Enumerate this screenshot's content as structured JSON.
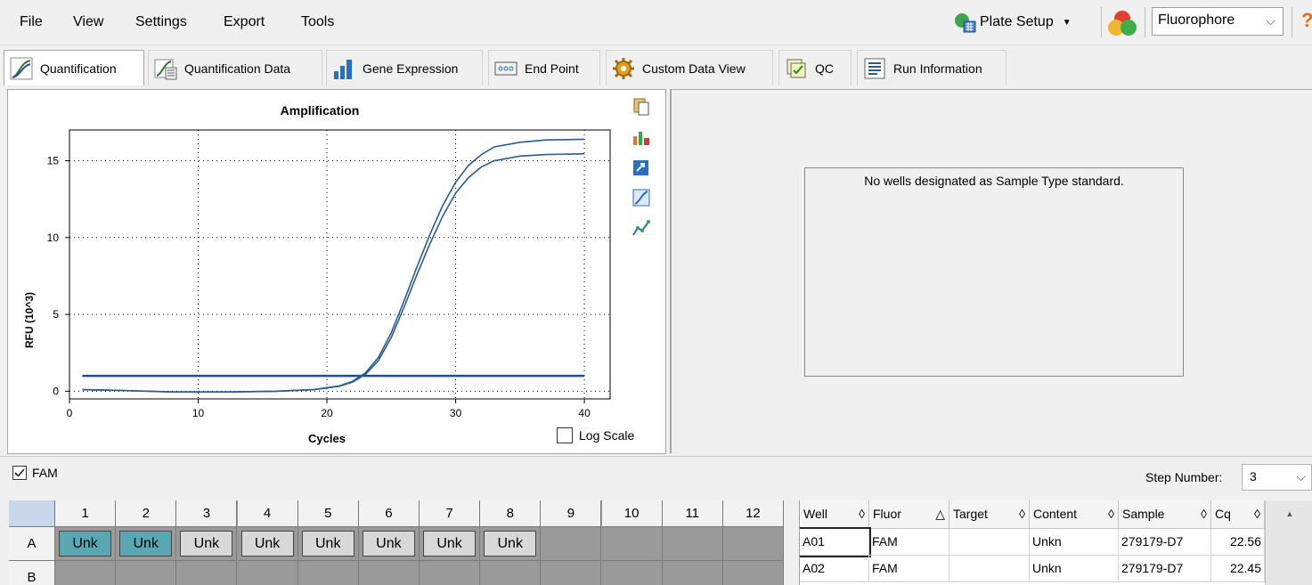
{
  "menu": [
    "File",
    "View",
    "Settings",
    "Export",
    "Tools"
  ],
  "toolbar": {
    "plate_setup_label": "Plate Setup",
    "fluorophore_label": "Fluorophore"
  },
  "tabs": [
    {
      "label": "Quantification"
    },
    {
      "label": "Quantification Data"
    },
    {
      "label": "Gene Expression"
    },
    {
      "label": "End Point"
    },
    {
      "label": "Custom Data View"
    },
    {
      "label": "QC"
    },
    {
      "label": "Run Information"
    }
  ],
  "chart_data": {
    "type": "line",
    "title": "Amplification",
    "xlabel": "Cycles",
    "ylabel": "RFU (10^3)",
    "xlim": [
      0,
      42
    ],
    "ylim": [
      -0.5,
      17
    ],
    "xticks": [
      0,
      10,
      20,
      30,
      40
    ],
    "yticks": [
      0,
      5,
      10,
      15
    ],
    "grid": "dotted",
    "threshold": 1.0,
    "series": [
      {
        "x": [
          1,
          4,
          8,
          12,
          16,
          19,
          21,
          22,
          23,
          24,
          25,
          26,
          27,
          28,
          29,
          30,
          31,
          32,
          33,
          35,
          37,
          40
        ],
        "y": [
          0.1,
          0.05,
          -0.05,
          -0.05,
          0.0,
          0.1,
          0.35,
          0.65,
          1.2,
          2.2,
          3.8,
          5.9,
          8.1,
          10.2,
          12.1,
          13.6,
          14.7,
          15.4,
          15.9,
          16.2,
          16.35,
          16.4
        ]
      },
      {
        "x": [
          1,
          4,
          8,
          12,
          16,
          19,
          21,
          22,
          23,
          24,
          25,
          26,
          27,
          28,
          29,
          30,
          31,
          32,
          33,
          35,
          37,
          40
        ],
        "y": [
          0.1,
          0.05,
          -0.05,
          -0.05,
          0.0,
          0.1,
          0.33,
          0.6,
          1.1,
          2.0,
          3.5,
          5.5,
          7.6,
          9.6,
          11.4,
          12.9,
          13.9,
          14.6,
          15.0,
          15.3,
          15.4,
          15.45
        ]
      }
    ]
  },
  "log_scale_label": "Log Scale",
  "std_message": "No wells designated as Sample Type standard.",
  "filter": {
    "fam_label": "FAM",
    "step_label": "Step Number:",
    "step_value": "3"
  },
  "plate": {
    "columns": [
      "1",
      "2",
      "3",
      "4",
      "5",
      "6",
      "7",
      "8",
      "9",
      "10",
      "11",
      "12"
    ],
    "rows": [
      {
        "label": "A",
        "cells": [
          "Unk",
          "Unk",
          "Unk",
          "Unk",
          "Unk",
          "Unk",
          "Unk",
          "Unk",
          "",
          "",
          "",
          ""
        ]
      },
      {
        "label": "B",
        "cells": [
          "",
          "",
          "",
          "",
          "",
          "",
          "",
          "",
          "",
          "",
          "",
          ""
        ]
      }
    ]
  },
  "results": {
    "headers": [
      "Well",
      "Fluor",
      "Target",
      "Content",
      "Sample",
      "Cq"
    ],
    "rows": [
      [
        "A01",
        "FAM",
        "",
        "Unkn",
        "279179-D7",
        "22.56"
      ],
      [
        "A02",
        "FAM",
        "",
        "Unkn",
        "279179-D7",
        "22.45"
      ]
    ]
  },
  "colors": {
    "curve": "#2a5b8c",
    "threshold": "#1f4e8c",
    "selected_well": "#5aa7b4",
    "plate_bg": "#9a9a9a"
  }
}
